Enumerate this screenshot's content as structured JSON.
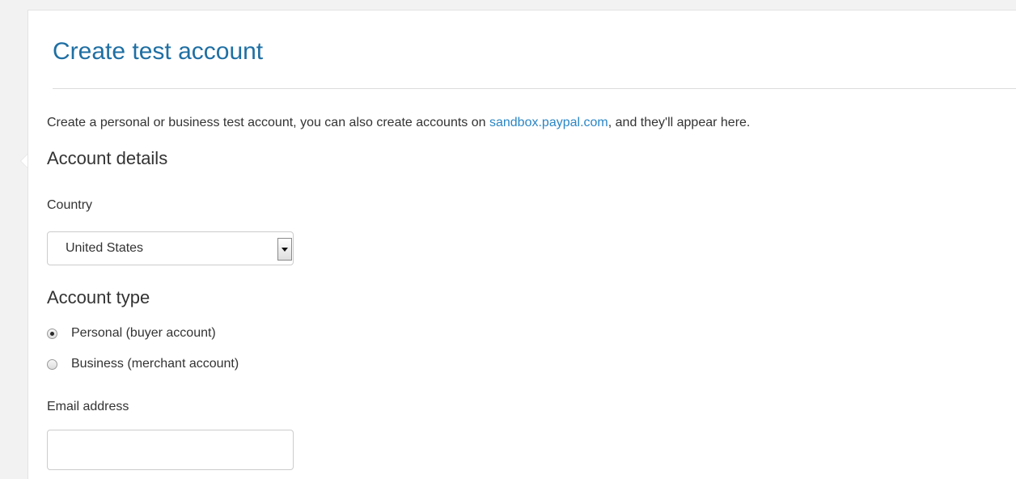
{
  "page": {
    "title": "Create test account"
  },
  "intro": {
    "text_before": "Create a personal or business test account, you can also create accounts on ",
    "link": "sandbox.paypal.com",
    "text_after": ", and they'll appear here."
  },
  "account_details": {
    "heading": "Account details",
    "country_label": "Country",
    "country_value": "United States"
  },
  "account_type": {
    "heading": "Account type",
    "options": [
      {
        "label": "Personal (buyer account)",
        "selected": true
      },
      {
        "label": "Business (merchant account)",
        "selected": false
      }
    ]
  },
  "email": {
    "label": "Email address",
    "value": ""
  },
  "colors": {
    "title": "#1f6fa3",
    "link": "#2b86c5",
    "text": "#333333"
  },
  "icons": {
    "select_arrow": "chevron-down-icon"
  }
}
